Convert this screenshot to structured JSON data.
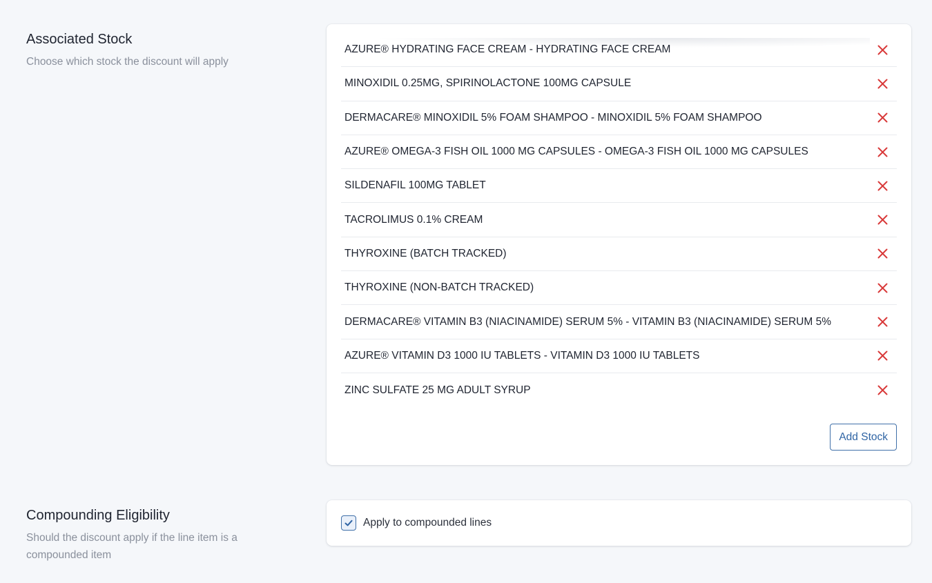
{
  "associated_stock": {
    "title": "Associated Stock",
    "description": "Choose which stock the discount will apply",
    "items": [
      "AZURE® HYDRATING FACE CREAM - HYDRATING FACE CREAM",
      "MINOXIDIL 0.25MG, SPIRINOLACTONE 100MG CAPSULE",
      "DERMACARE® MINOXIDIL 5% FOAM SHAMPOO - MINOXIDIL 5% FOAM SHAMPOO",
      "AZURE® OMEGA-3 FISH OIL 1000 MG CAPSULES - OMEGA-3 FISH OIL 1000 MG CAPSULES",
      "SILDENAFIL 100MG TABLET",
      "TACROLIMUS 0.1% CREAM",
      "THYROXINE (BATCH TRACKED)",
      "THYROXINE (NON-BATCH TRACKED)",
      "DERMACARE® VITAMIN B3 (NIACINAMIDE) SERUM 5% - VITAMIN B3 (NIACINAMIDE) SERUM 5%",
      "AZURE® VITAMIN D3 1000 IU TABLETS - VITAMIN D3 1000 IU TABLETS",
      "ZINC SULFATE 25 MG ADULT SYRUP"
    ],
    "remove_icon": "close-icon",
    "add_button_label": "Add Stock"
  },
  "compounding": {
    "title": "Compounding Eligibility",
    "description": "Should the discount apply if the line item is a compounded item",
    "checkbox_label": "Apply to compounded lines",
    "checked": true
  },
  "colors": {
    "background": "#f5f7fa",
    "accent": "#2f64a4",
    "remove": "#d93a3a"
  }
}
